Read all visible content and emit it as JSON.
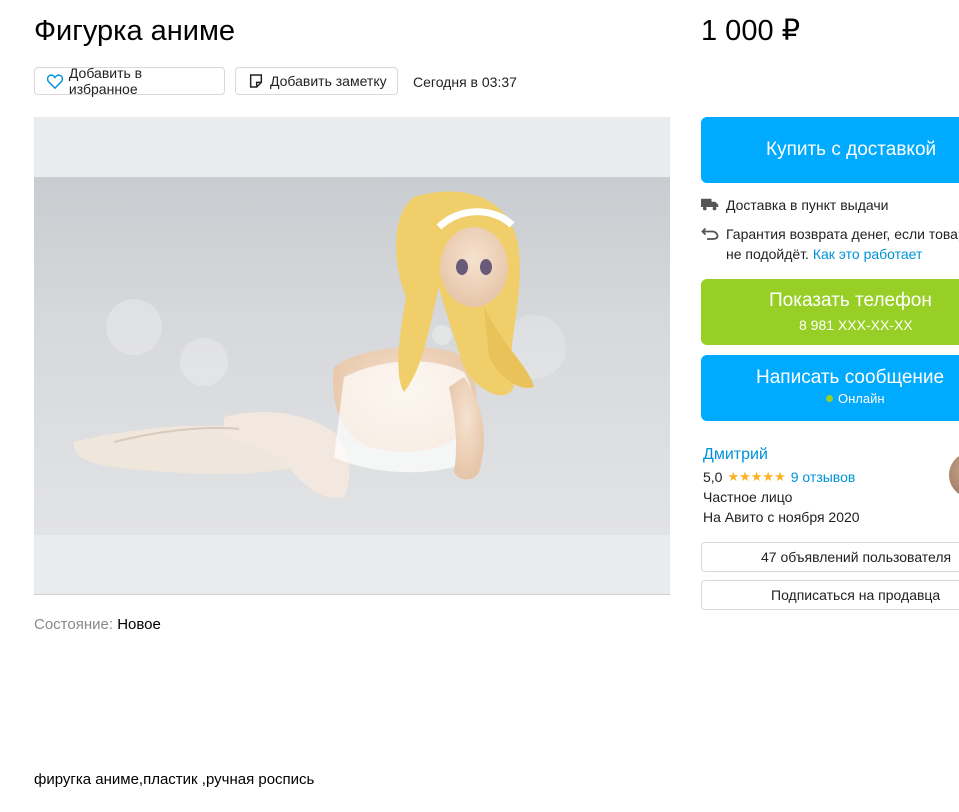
{
  "listing": {
    "title": "Фигурка аниме",
    "price": "1 000 ₽",
    "favorite_label": "Добавить в избранное",
    "note_label": "Добавить заметку",
    "posted": "Сегодня в 03:37",
    "condition_label": "Состояние:",
    "condition_value": "Новое",
    "description": "фиругка аниме,пластик ,ручная роспись"
  },
  "actions": {
    "buy_label": "Купить с доставкой",
    "delivery_text": "Доставка в пункт выдачи",
    "guarantee_text": "Гарантия возврата денег, если товар не подойдёт.",
    "guarantee_link": "Как это работает",
    "phone_label": "Показать телефон",
    "phone_masked": "8 981 XXX-XX-XX",
    "message_label": "Написать сообщение",
    "online_status": "Онлайн"
  },
  "seller": {
    "name": "Дмитрий",
    "rating": "5,0",
    "stars": "★★★★★",
    "reviews": "9 отзывов",
    "type": "Частное лицо",
    "since": "На Авито с ноября 2020",
    "listings_button": "47 объявлений пользователя",
    "subscribe_button": "Подписаться на продавца"
  },
  "colors": {
    "accent_blue": "#00aaff",
    "phone_green": "#97cf26",
    "link": "#0091d9",
    "star": "#ffb021"
  },
  "icons": [
    "heart-icon",
    "note-icon",
    "truck-icon",
    "return-arrow-icon"
  ]
}
